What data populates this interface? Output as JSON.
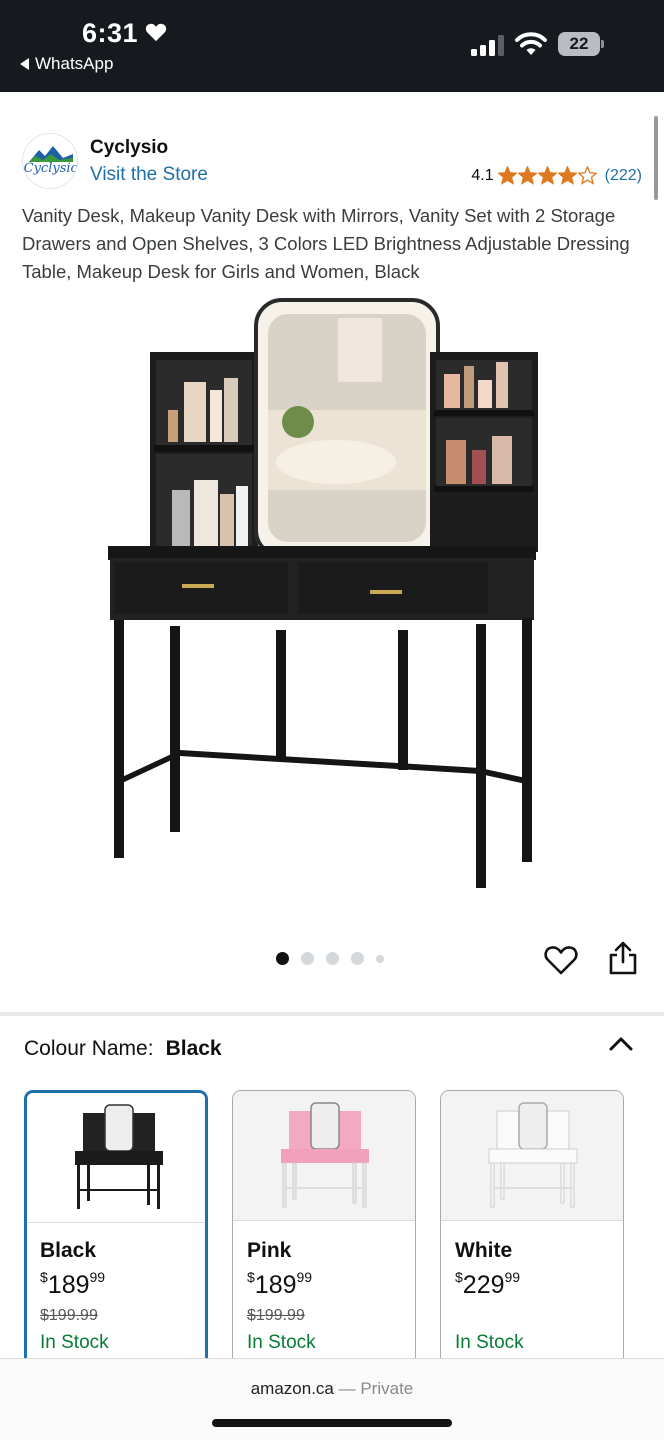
{
  "status_bar": {
    "time": "6:31",
    "back_app": "WhatsApp",
    "battery": "22",
    "icons": [
      "heart-icon",
      "signal-icon",
      "wifi-icon",
      "battery-icon"
    ]
  },
  "brand": {
    "name": "Cyclysio",
    "logo_text": "Cyclysio",
    "visit_store": "Visit the Store"
  },
  "rating": {
    "value": "4.1",
    "stars": 4.1,
    "count": "(222)",
    "star_color": "#de7921"
  },
  "product": {
    "title": "Vanity Desk, Makeup Vanity Desk with Mirrors, Vanity Set with 2 Storage Drawers and Open Shelves, 3 Colors LED Brightness Adjustable Dressing Table, Makeup Desk for Girls and Women, Black"
  },
  "gallery": {
    "total_images": 5,
    "active_index": 0
  },
  "colour": {
    "label": "Colour Name:",
    "selected": "Black",
    "options": [
      {
        "name": "Black",
        "currency": "$",
        "price_whole": "189",
        "price_fraction": "99",
        "list_price": "$199.99",
        "stock": "In Stock",
        "swatch": "#1b1b1b"
      },
      {
        "name": "Pink",
        "currency": "$",
        "price_whole": "189",
        "price_fraction": "99",
        "list_price": "$199.99",
        "stock": "In Stock",
        "swatch": "#f0a7c0"
      },
      {
        "name": "White",
        "currency": "$",
        "price_whole": "229",
        "price_fraction": "99",
        "list_price": "",
        "stock": "In Stock",
        "swatch": "#f4f4f4"
      }
    ]
  },
  "browser": {
    "domain": "amazon.ca",
    "separator": " — ",
    "mode": "Private"
  },
  "colors": {
    "link": "#1f6fa8",
    "in_stock": "#067d35",
    "selected_border": "#1f6fa8"
  }
}
